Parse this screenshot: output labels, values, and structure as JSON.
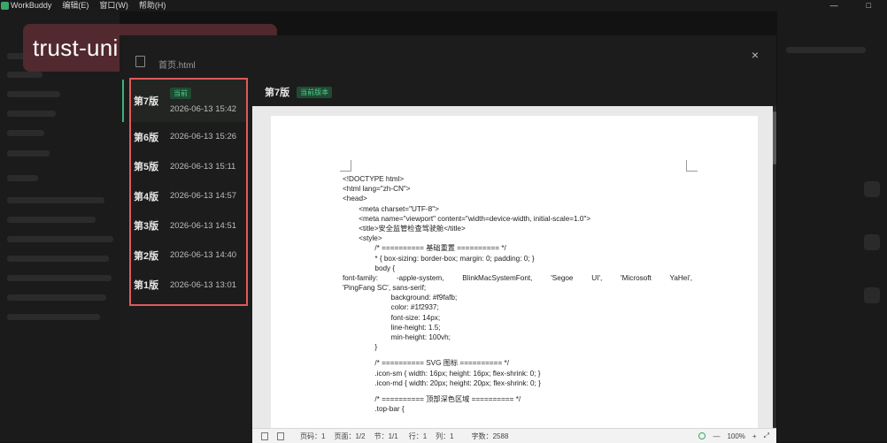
{
  "app": {
    "name": "WorkBuddy",
    "menu": [
      "编辑(E)",
      "窗口(W)",
      "帮助(H)"
    ],
    "window_controls": [
      "—",
      "□"
    ]
  },
  "banner": {
    "text": "trust-unibet.com.cn"
  },
  "modal": {
    "title": "首页.html",
    "close": "×",
    "versions": [
      {
        "name": "第7版",
        "time": "2026-06-13 15:42",
        "badge": "当前"
      },
      {
        "name": "第6版",
        "time": "2026-06-13 15:26"
      },
      {
        "name": "第5版",
        "time": "2026-06-13 15:11"
      },
      {
        "name": "第4版",
        "time": "2026-06-13 14:57"
      },
      {
        "name": "第3版",
        "time": "2026-06-13 14:51"
      },
      {
        "name": "第2版",
        "time": "2026-06-13 14:40"
      },
      {
        "name": "第1版",
        "time": "2026-06-13 13:01"
      }
    ],
    "preview": {
      "title": "第7版",
      "badge": "当前版本",
      "code_lines": [
        "<!DOCTYPE html>",
        "<html lang=\"zh-CN\">",
        "<head>",
        "        <meta charset=\"UTF-8\">",
        "        <meta name=\"viewport\" content=\"width=device-width, initial-scale=1.0\">",
        "        <title>安全监管检查驾驶舱</title>",
        "        <style>",
        "                /* ========== 基础重置 ========== */",
        "                * { box-sizing: border-box; margin: 0; padding: 0; }",
        "                body {",
        "                        font-family:   -apple-system,   BlinkMacSystemFont,   'Segoe   UI',   'Microsoft   YaHei',",
        "'PingFang SC', sans-serif;",
        "                        background: #f9fafb;",
        "                        color: #1f2937;",
        "                        font-size: 14px;",
        "                        line-height: 1.5;",
        "                        min-height: 100vh;",
        "                }",
        "",
        "                /* ========== SVG 图标 ========== */",
        "                .icon-sm { width: 16px; height: 16px; flex-shrink: 0; }",
        "                .icon-md { width: 20px; height: 20px; flex-shrink: 0; }",
        "",
        "                /* ========== 顶部深色区域 ========== */",
        "                .top-bar {"
      ],
      "status": {
        "page_code": "页码：1",
        "page": "页面：1/2",
        "section": "节：1/1",
        "row": "行：1",
        "col": "列：1",
        "word_count": "字数：2588",
        "zoom": "100%"
      }
    }
  }
}
